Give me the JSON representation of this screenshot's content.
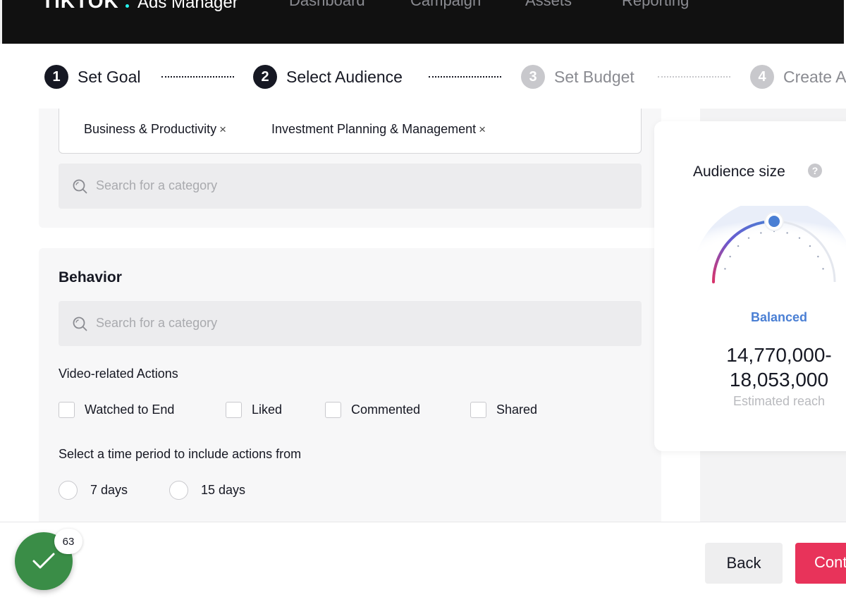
{
  "nav": {
    "brand": "TIKTOK",
    "product": "Ads Manager",
    "links": [
      "Dashboard",
      "Campaign",
      "Assets",
      "Reporting"
    ]
  },
  "stepper": {
    "steps": [
      {
        "num": "1",
        "label": "Set Goal",
        "state": "active"
      },
      {
        "num": "2",
        "label": "Select Audience",
        "state": "active"
      },
      {
        "num": "3",
        "label": "Set Budget",
        "state": "inactive"
      },
      {
        "num": "4",
        "label": "Create Ad",
        "state": "inactive"
      }
    ]
  },
  "interests": {
    "tags": [
      "Business & Productivity",
      "Investment Planning & Management"
    ],
    "remove_glyph": "×",
    "search_placeholder": "Search for a category"
  },
  "behavior": {
    "title": "Behavior",
    "search_placeholder": "Search for a category",
    "video_actions_label": "Video-related Actions",
    "checkboxes": [
      "Watched to End",
      "Liked",
      "Commented",
      "Shared"
    ],
    "period_label": "Select a time period to include actions from",
    "radios": [
      "7 days",
      "15 days"
    ]
  },
  "audience": {
    "title": "Audience size",
    "help_glyph": "?",
    "status": "Balanced",
    "range_low": "14,770,000-",
    "range_high": "18,053,000",
    "note": "Estimated reach",
    "gauge_level": 0.5
  },
  "footer": {
    "back_label": "Back",
    "continue_label": "Continue",
    "badge_count": "63"
  },
  "colors": {
    "nav_bg": "#111111",
    "accent": "#e8335a",
    "balanced_blue": "#4a7fd4",
    "fab_green": "#3a8d47"
  },
  "icons": {
    "search": "search-icon",
    "help": "help-icon",
    "check": "check-icon"
  }
}
